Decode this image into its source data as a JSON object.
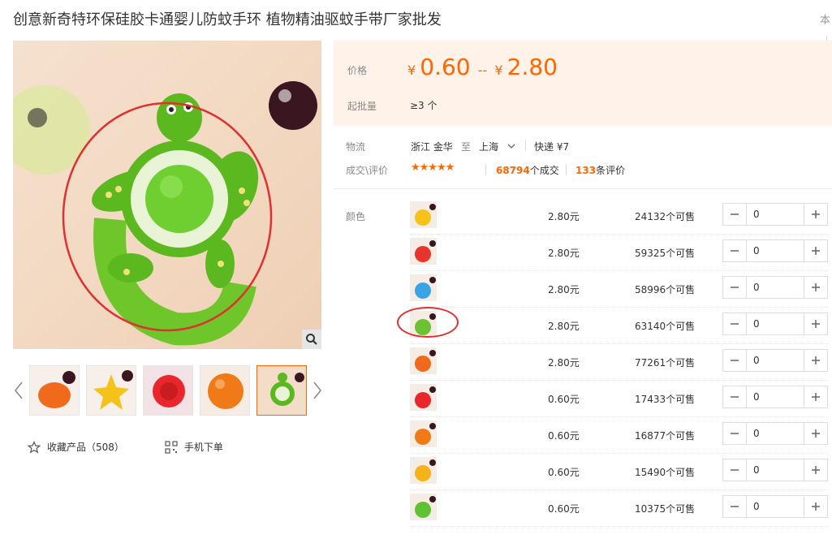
{
  "title": "创意新奇特环保硅胶卡通婴儿防蚊手环 植物精油驱蚊手带厂家批发",
  "title_right": "本",
  "price": {
    "label": "价格",
    "currency": "¥",
    "low": "0.60",
    "dash": "--",
    "high": "2.80",
    "moq_label": "起批量",
    "moq_value": "≥3 个"
  },
  "logistics": {
    "label": "物流",
    "from": "浙江 金华",
    "to_word": "至",
    "to": "上海",
    "express": "快递 ¥7"
  },
  "deals": {
    "label": "成交\\评价",
    "stars": "★★★★★",
    "count": "68794",
    "count_suffix": "个成交",
    "reviews": "133",
    "reviews_suffix": "条评价"
  },
  "color_label": "颜色",
  "actions": {
    "favorite": "收藏产品（508）",
    "mobile": "手机下单"
  },
  "skus": [
    {
      "price": "2.80元",
      "stock": "24132个可售",
      "qty": "0",
      "color": "#f5c21a"
    },
    {
      "price": "2.80元",
      "stock": "59325个可售",
      "qty": "0",
      "color": "#e8352b"
    },
    {
      "price": "2.80元",
      "stock": "58996个可售",
      "qty": "0",
      "color": "#3aa3e8"
    },
    {
      "price": "2.80元",
      "stock": "63140个可售",
      "qty": "0",
      "color": "#6bc234"
    },
    {
      "price": "2.80元",
      "stock": "77261个可售",
      "qty": "0",
      "color": "#f06a1c"
    },
    {
      "price": "0.60元",
      "stock": "17433个可售",
      "qty": "0",
      "color": "#e8262b"
    },
    {
      "price": "0.60元",
      "stock": "16877个可售",
      "qty": "0",
      "color": "#f07a18"
    },
    {
      "price": "0.60元",
      "stock": "15490个可售",
      "qty": "0",
      "color": "#f5b21a"
    },
    {
      "price": "0.60元",
      "stock": "10375个可售",
      "qty": "0",
      "color": "#5ec232"
    }
  ],
  "colors": {
    "accent": "#ff6600",
    "annotation": "#e0302f"
  }
}
